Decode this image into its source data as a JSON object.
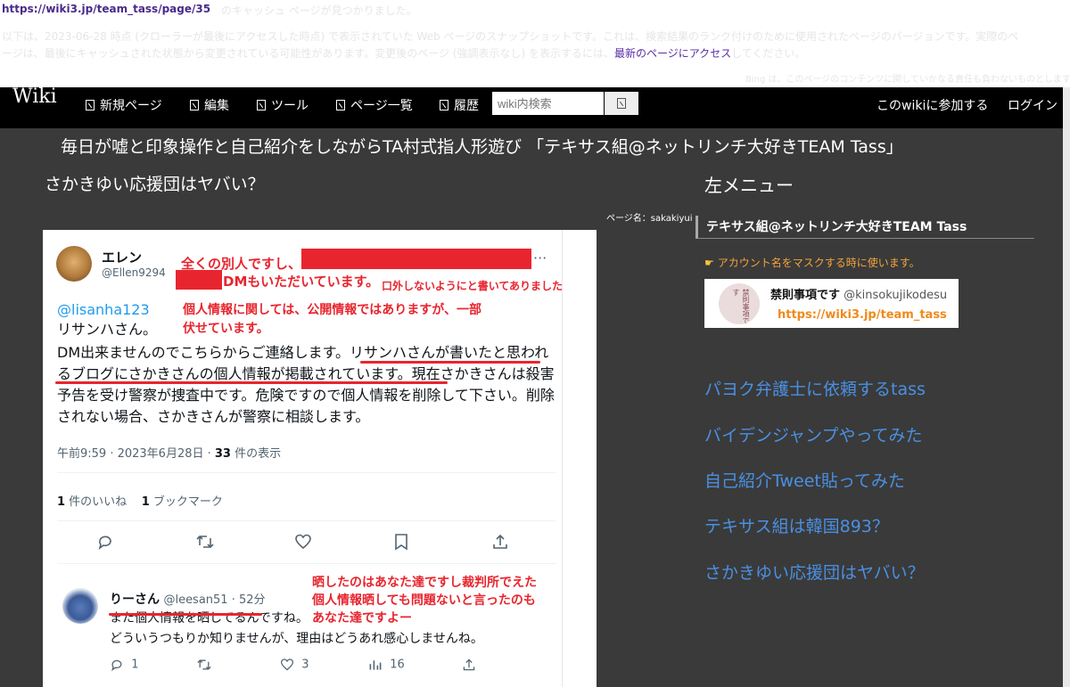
{
  "cache": {
    "url": "https://wiki3.jp/team_tass/page/35",
    "notice_line1": "のキャッシュ ページが見つかりました。",
    "notice_line2": "以下は、2023-06-28 時点 (クローラーが最後にアクセスした時点) で表示されていた Web ページのスナップショットです。これは、検索結果のランク付けのために使用されたページのバージョンです。実際のペ",
    "notice_line3": "ージは、最後にキャッシュされた状態から変更されている可能性があります。変更後のページ (強調表示なし) を表示するには、",
    "latest_link": "最新のページにアクセス",
    "notice_line3_tail": "してください。",
    "disclaimer": "Bing は、このページのコンテンツに関していかなる責任も負わないものとします。"
  },
  "nav": {
    "logo": "Wiki",
    "items": [
      "新規ページ",
      "編集",
      "ツール",
      "ページ一覧",
      "履歴"
    ],
    "search_placeholder": "wiki内検索",
    "join": "このwikiに参加する",
    "login": "ログイン"
  },
  "page": {
    "title": "毎日が嘘と印象操作と自己紹介をしながらTA村式指人形遊び 「テキサス組@ネットリンチ大好きTEAM Tass」",
    "subtitle": "さかきゆい応援団はヤバい？",
    "page_name": "ページ名：sakakiyui"
  },
  "sidebar": {
    "title": "左メニュー",
    "section": "テキサス組@ネットリンチ大好きTEAM Tass",
    "notice": "アカウント名をマスクする時に使います。",
    "profile_name": "禁則事項です",
    "profile_handle": "@kinsokujikodesu",
    "profile_avatar_text": "禁則事項です",
    "profile_url": "https://wiki3.jp/team_tass",
    "links": [
      "パヨク弁護士に依頼するtass",
      "バイデンジャンプやってみた",
      "自己紹介Tweet貼ってみた",
      "テキサス組は韓国893？",
      "さかきゆい応援団はヤバい？"
    ]
  },
  "tweet": {
    "name": "エレン",
    "handle": "@Ellen9294",
    "more": "···",
    "mention": "@lisanha123",
    "line1": "リサンハさん。",
    "body_pre": "DM出来ませんのでこちらからご連絡します。",
    "body_hl": "リサンハさんが書いたと思われるブログにさかきさんの個人情報が掲載されています。",
    "body_post": "現在さかきさんは殺害予告を受け警察が捜査中です。危険ですので個人情報を削除して下さい。削除されない場合、さかきさんが警察に相談します。",
    "time": "午前9:59 · 2023年6月28日 · ",
    "views_count": "33",
    "views_label": " 件の表示",
    "likes_count": "1",
    "likes_label": " 件のいいね",
    "bookmarks_count": "1",
    "bookmarks_label": " ブックマーク"
  },
  "reply": {
    "name": "りーさん",
    "handle": "@leesan51 · 52分",
    "line1": "また個人情報を晒してるんですね。",
    "line2": "どういうつもりか知りませんが、理由はどうあれ感心しませんね。",
    "reply_count": "1",
    "like_count": "3",
    "view_count": "16"
  },
  "annotations": {
    "a1": "全くの別人ですし、",
    "a2": "DMもいただいています。",
    "a2_small": "口外しないようにと書いてありました",
    "a3_line1": "個人情報に関しては、公開情報ではありますが、一部",
    "a3_line2": "伏せています。",
    "a4_line1": "晒したのはあなた達ですし裁判所でえた",
    "a4_line2": "個人情報晒しても問題ないと言ったのも",
    "a4_line3": "あなた達ですよー"
  },
  "colors": {
    "nav_bg": "#000000",
    "content_bg": "#3a3a3a",
    "link": "#4a90e2",
    "annotation_red": "#e8252e",
    "notice_orange": "#f3a33b",
    "twitter_blue": "#1d9bf0"
  }
}
